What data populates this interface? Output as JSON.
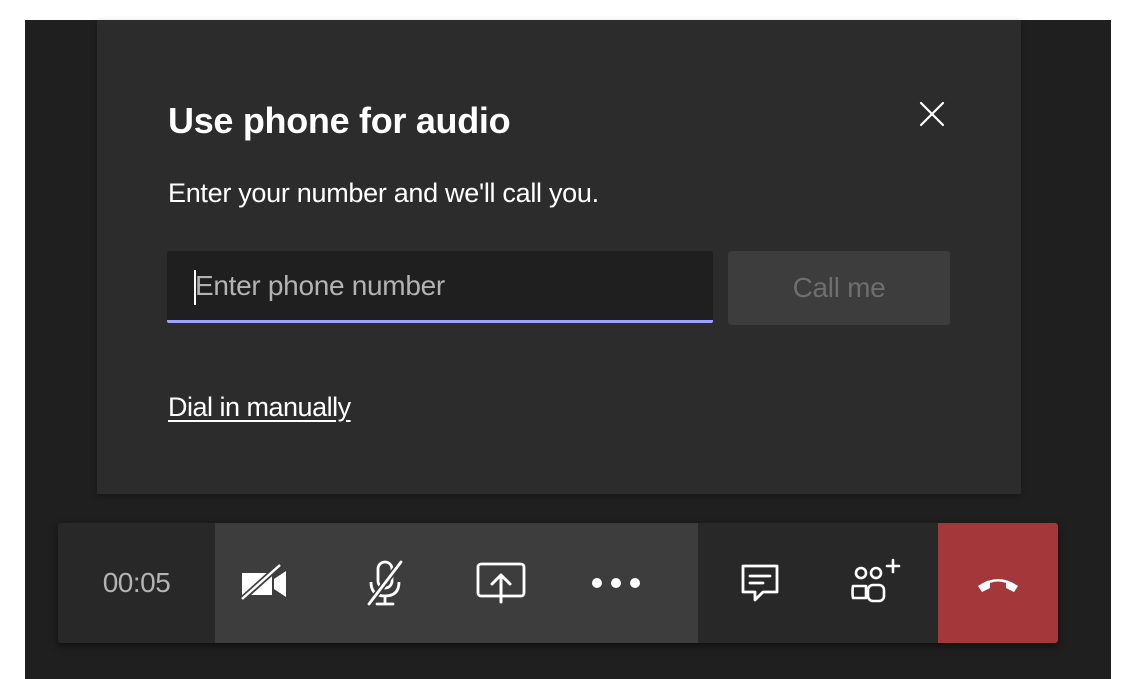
{
  "dialog": {
    "title": "Use phone for audio",
    "subtitle": "Enter your number and we'll call you.",
    "phone_input": {
      "placeholder": "Enter phone number",
      "value": ""
    },
    "call_button_label": "Call me",
    "dial_in_link": "Dial in manually",
    "close_icon": "close-icon"
  },
  "toolbar": {
    "timer": "00:05",
    "buttons": [
      {
        "name": "camera-off",
        "icon": "camera-off-icon"
      },
      {
        "name": "mic-muted",
        "icon": "mic-off-icon"
      },
      {
        "name": "share-screen",
        "icon": "share-tray-icon"
      },
      {
        "name": "more-actions",
        "icon": "ellipsis-icon"
      },
      {
        "name": "chat",
        "icon": "chat-icon"
      },
      {
        "name": "participants",
        "icon": "people-add-icon"
      },
      {
        "name": "hang-up",
        "icon": "phone-hangup-icon"
      }
    ]
  },
  "colors": {
    "background": "#1f1f1f",
    "dialog": "#2d2c2c",
    "input_underline": "#9ea2ff",
    "hangup": "#a4373a"
  }
}
